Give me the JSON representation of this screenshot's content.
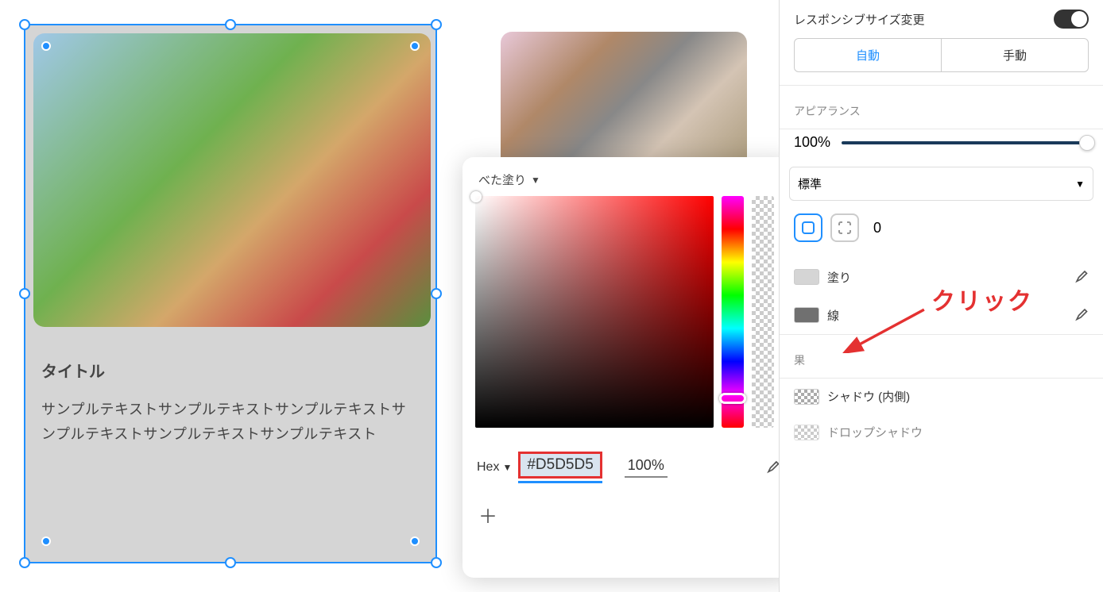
{
  "canvas": {
    "card1": {
      "title": "タイトル",
      "body": "サンプルテキストサンプルテキストサンプルテキストサンプルテキストサンプルテキストサンプルテキスト"
    }
  },
  "color_picker": {
    "mode_label": "べた塗り",
    "format_label": "Hex",
    "hex_value": "#D5D5D5",
    "opacity_value": "100%"
  },
  "panel": {
    "responsive_label": "レスポンシブサイズ変更",
    "responsive_on": true,
    "mode_auto": "自動",
    "mode_manual": "手動",
    "appearance_label": "アピアランス",
    "opacity": "100%",
    "blend_label": "標準",
    "corner_radius": "0",
    "fill_label": "塗り",
    "fill_swatch": "#d5d5d5",
    "stroke_label": "線",
    "stroke_swatch": "#707070",
    "effect_trail": "果",
    "shadow_inner": "シャドウ (内側)",
    "drop_shadow": "ドロップシャドウ"
  },
  "annotation": "クリック"
}
